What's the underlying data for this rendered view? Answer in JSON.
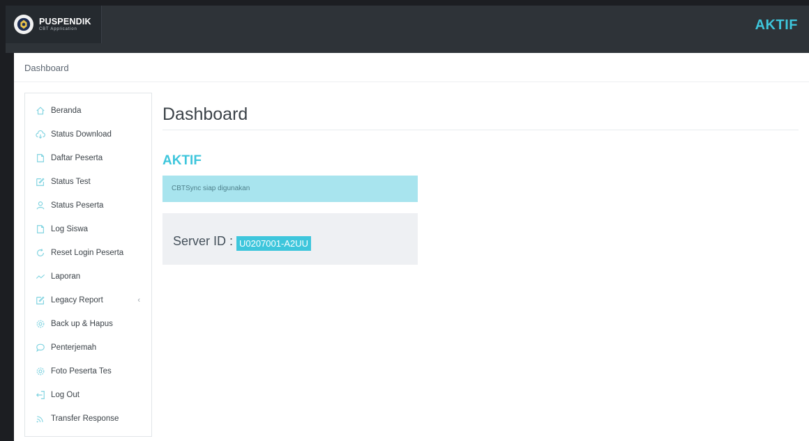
{
  "header": {
    "logo_title": "PUSPENDIK",
    "logo_subtitle": "CBT Application",
    "status": "AKTIF"
  },
  "breadcrumb": "Dashboard",
  "sidebar": {
    "items": [
      {
        "label": "Beranda",
        "icon": "home-icon"
      },
      {
        "label": "Status Download",
        "icon": "cloud-download-icon"
      },
      {
        "label": "Daftar Peserta",
        "icon": "document-icon"
      },
      {
        "label": "Status Test",
        "icon": "edit-icon"
      },
      {
        "label": "Status Peserta",
        "icon": "user-icon"
      },
      {
        "label": "Log Siswa",
        "icon": "document-icon"
      },
      {
        "label": "Reset Login Peserta",
        "icon": "refresh-icon"
      },
      {
        "label": "Laporan",
        "icon": "trend-line-icon"
      },
      {
        "label": "Legacy Report",
        "icon": "edit-icon",
        "has_submenu": true
      },
      {
        "label": "Back up & Hapus",
        "icon": "gear-icon"
      },
      {
        "label": "Penterjemah",
        "icon": "chat-icon"
      },
      {
        "label": "Foto Peserta Tes",
        "icon": "gear-icon"
      },
      {
        "label": "Log Out",
        "icon": "logout-icon"
      },
      {
        "label": "Transfer Response",
        "icon": "wifi-icon"
      }
    ]
  },
  "main": {
    "title": "Dashboard",
    "status_heading": "AKTIF",
    "alert_text": "CBTSync siap digunakan",
    "server_label": "Server ID :",
    "server_id": "U0207001-A2UU"
  },
  "colors": {
    "accent": "#3ec6dc",
    "topbar": "#2e3338",
    "alert_bg": "#a8e4ee",
    "icon": "#7fd3e0"
  }
}
